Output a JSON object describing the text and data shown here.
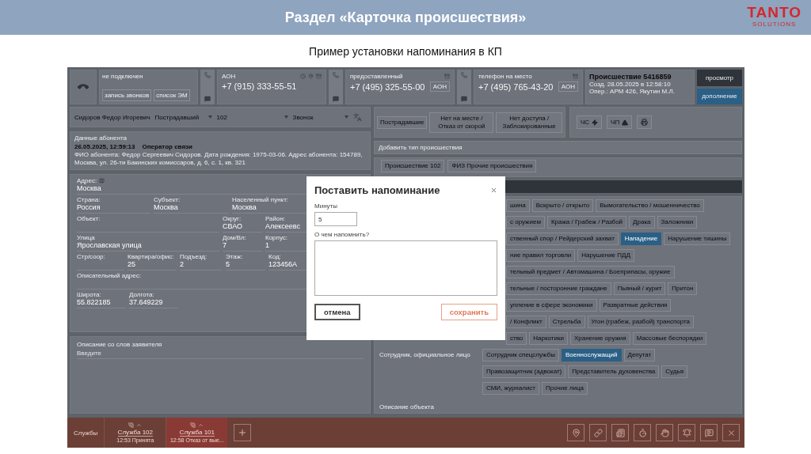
{
  "slide": {
    "title": "Раздел «Карточка происшествия»",
    "logo": "TANTO",
    "logo_sub": "SOLUTIONS",
    "subtitle": "Пример установки напоминания в КП"
  },
  "call_bar": {
    "status": "не подключен",
    "buttons": [
      "запись звонков",
      "список ЭМ"
    ]
  },
  "phones": [
    {
      "kind": "aon",
      "label": "АОН",
      "number": "+7 (915) 333-55-51"
    },
    {
      "kind": "other",
      "label": "предоставленный",
      "number": "+7 (495) 325-55-00",
      "badge": "АОН"
    },
    {
      "kind": "other",
      "label": "телефон на место",
      "number": "+7 (495) 765-43-20",
      "badge": "АОН"
    }
  ],
  "incident": {
    "title": "Происшествие 5416859",
    "created": "Созд. 28.05.2025 в 12:58:10",
    "operator": "Опер.: АРМ 426, Якутин М.Л.",
    "view_button": "просмотр",
    "add_button": "дополнение"
  },
  "person": {
    "name": "Сидоров Федор Игоревич",
    "role": "Пострадавший",
    "service": "102",
    "source": "Звонок"
  },
  "subscriber": {
    "heading": "Данные абонента",
    "stamp": "26.05.2025, 12:59:13",
    "provider": "Оператор связи",
    "details": "ФИО абонента: Федор Сергеевич Сидоров. Дата рождения: 1975-03-06. Адрес абонента: 154789, Москва, ул. 26-ти Бакинских комиссаров, д. 6, с. 1, кв. 321"
  },
  "address": {
    "label": "Адрес:",
    "value": "Москва",
    "rows": [
      [
        {
          "label": "Страна:",
          "value": "Россия"
        },
        {
          "label": "Субъект:",
          "value": "Москва"
        },
        {
          "label": "Населенный пункт:",
          "value": "Москва"
        }
      ],
      [
        {
          "label": "Объект:"
        },
        {
          "label": "Округ:",
          "value": "СВАО"
        },
        {
          "label": "Район:",
          "value": "Алексеевс"
        }
      ],
      [
        {
          "label": "Улица",
          "value": "Ярославская улица"
        },
        {
          "label": "Дом/Вл:",
          "value": "7"
        },
        {
          "label": "Корпус:",
          "value": "1"
        }
      ],
      [
        {
          "label": "Стр/соор:"
        },
        {
          "label": "Квартира/офис:",
          "value": "25"
        },
        {
          "label": "Подъезд:",
          "value": "2"
        },
        {
          "label": "Этаж:",
          "value": "5"
        },
        {
          "label": "Код:",
          "value": "123456А"
        }
      ],
      [
        {
          "label": "Описательный адрес:"
        }
      ],
      [
        {
          "label": "Широта:",
          "value": "55.822185"
        },
        {
          "label": "Долгота:",
          "value": "37.649229"
        }
      ]
    ]
  },
  "description": {
    "label": "Описание со слов заявителя",
    "placeholder": "Введите"
  },
  "category_buttons": [
    "Пострадавшие",
    "Нет на месте / Отказ от скорой",
    "Нет доступа / Заблокированные"
  ],
  "flags": [
    {
      "kind": "emergency",
      "label": "ЧС"
    },
    {
      "kind": "accident",
      "label": "ЧП"
    },
    {
      "kind": "print"
    }
  ],
  "type_field": {
    "placeholder": "Добавить тип происшествия"
  },
  "type_tags": [
    "Происшествие 102",
    "ФИЗ Прочие происшествия"
  ],
  "incident_types": [
    [
      {
        "label": "шина",
        "selected": false
      },
      {
        "label": "Вскрыто / открыто",
        "selected": false
      },
      {
        "label": "Вымогательство / мошенничество",
        "selected": false
      }
    ],
    [
      {
        "label": "с оружием",
        "selected": false
      },
      {
        "label": "Кража / Грабеж / Разбой",
        "selected": false
      },
      {
        "label": "Драка",
        "selected": false
      },
      {
        "label": "Заложники",
        "selected": false
      }
    ],
    [
      {
        "label": "ственный спор / Рейдерский захват",
        "selected": false
      },
      {
        "label": "Нападение",
        "selected": true
      },
      {
        "label": "Нарушение тишины",
        "selected": false
      }
    ],
    [
      {
        "label": "ние правил торговли",
        "selected": false
      },
      {
        "label": "Нарушение ПДД",
        "selected": false
      }
    ],
    [
      {
        "label": "тельный предмет / Автомашина / Боеприпасы, оружие",
        "selected": false
      }
    ],
    [
      {
        "label": "тельные / посторонние граждане",
        "selected": false
      },
      {
        "label": "Пьяный / курит",
        "selected": false
      },
      {
        "label": "Притон",
        "selected": false
      }
    ],
    [
      {
        "label": "упление в сфере экономики",
        "selected": false
      },
      {
        "label": "Развратные действия",
        "selected": false
      }
    ],
    [
      {
        "label": "/ Конфликт",
        "selected": false
      },
      {
        "label": "Стрельба",
        "selected": false
      },
      {
        "label": "Угон (грабеж, разбой) транспорта",
        "selected": false
      }
    ],
    [
      {
        "label": "ство",
        "selected": false
      },
      {
        "label": "Наркотики",
        "selected": false
      },
      {
        "label": "Хранение оружия",
        "selected": false
      },
      {
        "label": "Массовые беспорядки",
        "selected": false
      }
    ]
  ],
  "persons": {
    "label": "Сотрудник, официальное лицо",
    "rows": [
      [
        {
          "label": "Сотрудник спецслужбы",
          "selected": false
        },
        {
          "label": "Военнослужащий",
          "selected": true
        },
        {
          "label": "Депутат",
          "selected": false
        }
      ],
      [
        {
          "label": "Правозащитник (адвокат)",
          "selected": false
        },
        {
          "label": "Представитель духовенства",
          "selected": false
        },
        {
          "label": "Судья",
          "selected": false
        }
      ],
      [
        {
          "label": "СМИ, журналист",
          "selected": false
        },
        {
          "label": "Прочие лица",
          "selected": false
        }
      ]
    ]
  },
  "object_label": "Описание объекта",
  "footer": {
    "label": "Службы",
    "tabs": [
      {
        "name": "Служба 102",
        "status": "12:53 Принята",
        "selected": false
      },
      {
        "name": "Служба 101",
        "status": "12:58 Отказ от вые...",
        "selected": true
      }
    ]
  },
  "dialog": {
    "title": "Поставить напоминание",
    "minutes_label": "Минуты",
    "minutes_value": "5",
    "note_label": "О чем напомнить?",
    "cancel": "отмена",
    "save": "сохранить"
  }
}
